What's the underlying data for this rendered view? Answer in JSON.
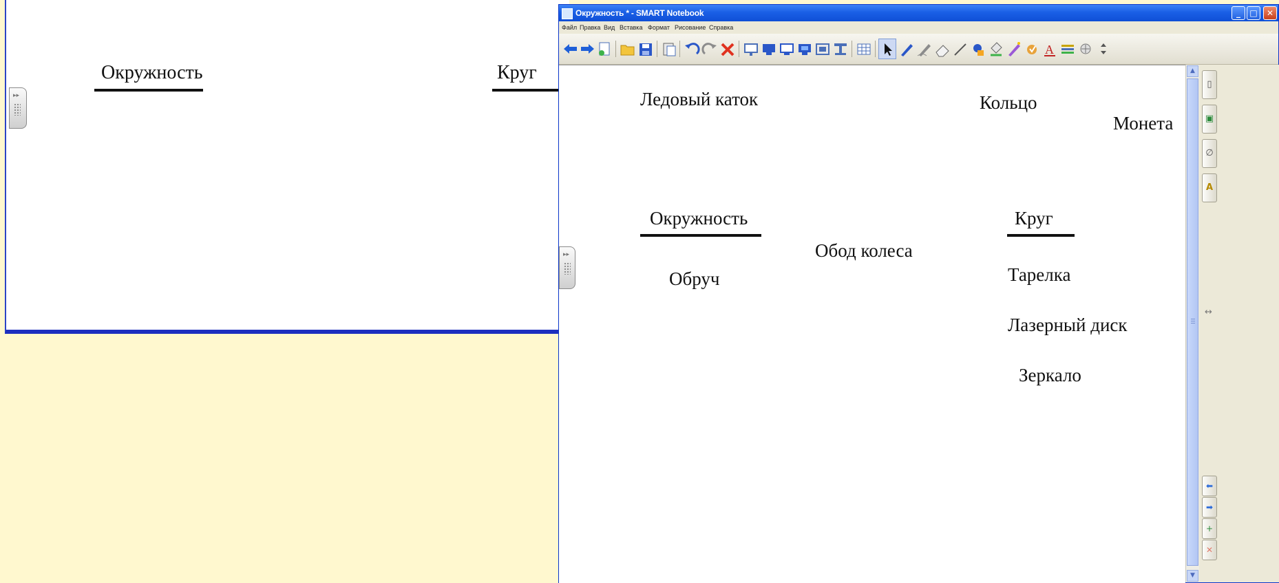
{
  "window": {
    "title": "Окружность * - SMART Notebook",
    "min_glyph": "_",
    "max_glyph": "□",
    "close_glyph": "✕"
  },
  "menu": [
    "Файл",
    "Правка",
    "Вид",
    "Вставка",
    "Формат",
    "Рисование",
    "Справка"
  ],
  "toolbar": {
    "icons": [
      "back-arrow-icon",
      "forward-arrow-icon",
      "page-icon",
      "open-folder-icon",
      "save-icon",
      "paste-icon",
      "undo-icon",
      "redo-icon",
      "delete-icon",
      "screen-shade-icon",
      "full-screen-icon",
      "dual-page-icon",
      "display-icon",
      "capture-icon",
      "document-camera-icon",
      "table-icon",
      "select-arrow-icon",
      "pen-icon",
      "creative-pen-icon",
      "eraser-icon",
      "line-icon",
      "shape-icon",
      "fill-icon",
      "magic-pen-icon",
      "recognition-icon",
      "text-icon",
      "properties-icon",
      "move-toolbar-icon"
    ],
    "text_tool_glyph": "A"
  },
  "background_window": {
    "words": [
      "Окружность",
      "Круг"
    ],
    "tab_arrows": "▸▸"
  },
  "page": {
    "words": {
      "ice_rink": "Ледовый каток",
      "ring": "Кольцо",
      "coin": "Монета",
      "circle_heading": "Окружность",
      "disk_heading": "Круг",
      "wheel_rim": "Обод колеса",
      "hoop": "Обруч",
      "plate": "Тарелка",
      "laser_disc": "Лазерный диск",
      "mirror": "Зеркало"
    },
    "tab_arrows": "▸▸"
  },
  "scrollbar": {
    "up_glyph": "▲",
    "down_glyph": "▼"
  },
  "sidebar": {
    "tabs": [
      "page-sorter-icon",
      "gallery-icon",
      "attachments-icon",
      "properties-icon"
    ],
    "resize_glyph": "↔",
    "nav": [
      "back-arrow-icon",
      "forward-arrow-icon",
      "add-page-icon",
      "delete-page-icon"
    ],
    "glyphs": {
      "page_sorter": "▯",
      "gallery": "▣",
      "attachments": "∅",
      "properties": "A",
      "back": "⬅",
      "forward": "➡",
      "add_page": "+",
      "delete_page": "✕"
    }
  }
}
